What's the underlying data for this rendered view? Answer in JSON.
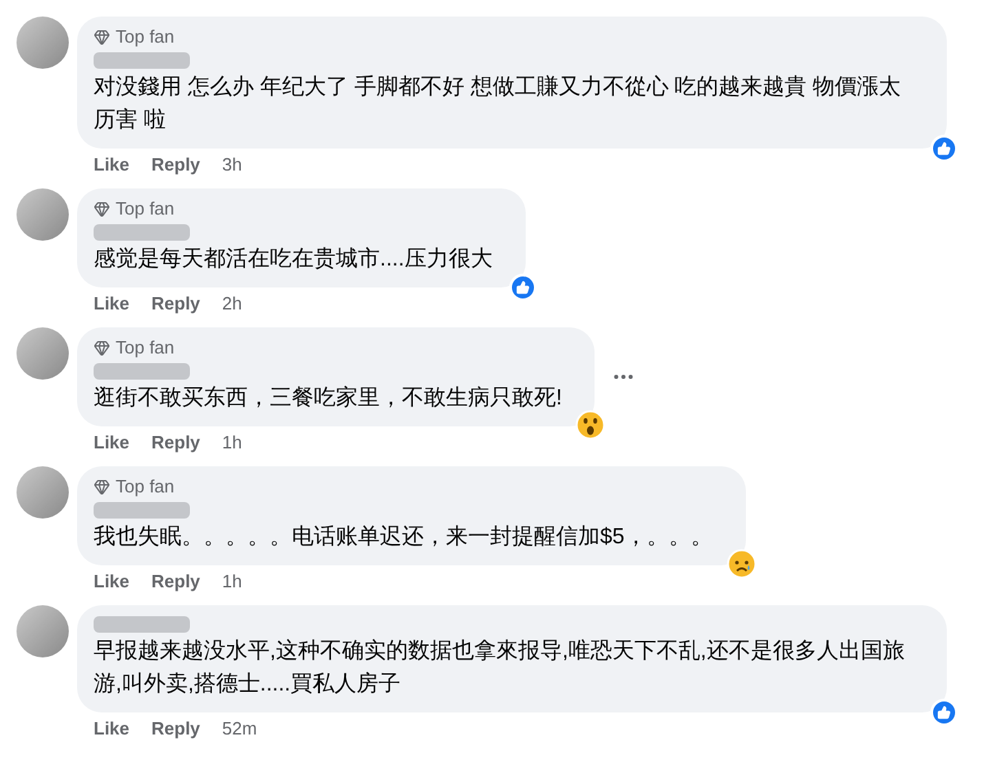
{
  "comments": [
    {
      "top_fan": true,
      "badge": "Top fan",
      "text": "对没錢用 怎么办 年纪大了 手脚都不好 想做工賺又力不從心 吃的越来越貴 物價漲太历害 啦",
      "actions": [
        "Like",
        "Reply"
      ],
      "time": "3h",
      "reaction": {
        "kind": "like"
      },
      "more_menu": false
    },
    {
      "top_fan": true,
      "badge": "Top fan",
      "text": "感觉是每天都活在吃在贵城市....压力很大",
      "actions": [
        "Like",
        "Reply"
      ],
      "time": "2h",
      "reaction": {
        "kind": "like"
      },
      "more_menu": false
    },
    {
      "top_fan": true,
      "badge": "Top fan",
      "text": "逛街不敢买东西，三餐吃家里，不敢生病只敢死!",
      "actions": [
        "Like",
        "Reply"
      ],
      "time": "1h",
      "reaction": {
        "kind": "wow"
      },
      "more_menu": true
    },
    {
      "top_fan": true,
      "badge": "Top fan",
      "text": "我也失眠。。。。。电话账单迟还，来一封提醒信加$5，。。。",
      "actions": [
        "Like",
        "Reply"
      ],
      "time": "1h",
      "reaction": {
        "kind": "sad"
      },
      "more_menu": false
    },
    {
      "top_fan": false,
      "text": "早报越来越没水平,这种不确实的数据也拿來报导,唯恐天下不乱,还不是很多人出国旅游,叫外卖,搭德士.....買私人房子",
      "actions": [
        "Like",
        "Reply"
      ],
      "time": "52m",
      "reaction": {
        "kind": "like"
      },
      "more_menu": false
    }
  ]
}
